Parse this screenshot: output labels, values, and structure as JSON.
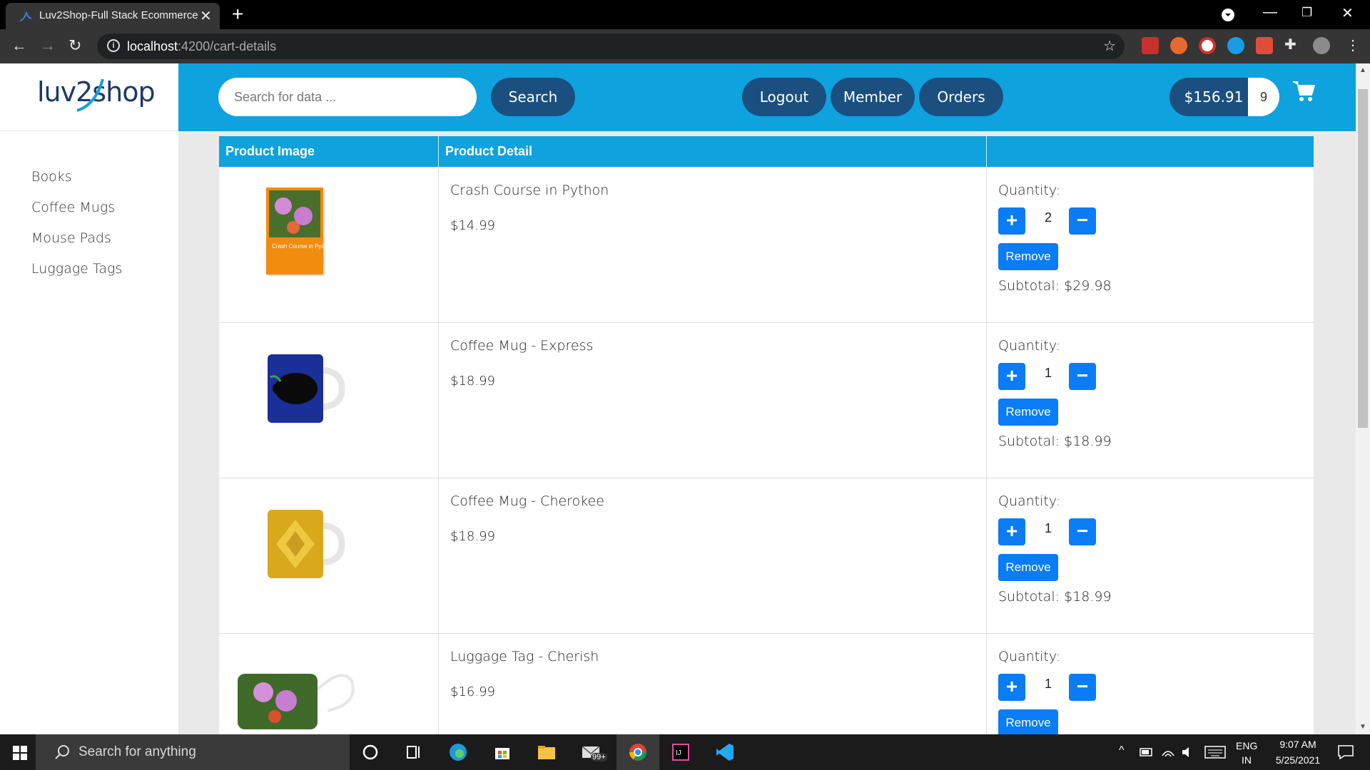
{
  "browser": {
    "tab_title": "Luv2Shop-Full Stack Ecommerce",
    "url_host": "localhost",
    "url_path": ":4200/cart-details"
  },
  "logo": {
    "text": "luv2shop"
  },
  "sidebar": {
    "items": [
      {
        "label": "Books"
      },
      {
        "label": "Coffee Mugs"
      },
      {
        "label": "Mouse Pads"
      },
      {
        "label": "Luggage Tags"
      }
    ]
  },
  "header": {
    "search_placeholder": "Search for data ...",
    "search_button": "Search",
    "logout": "Logout",
    "member": "Member",
    "orders": "Orders",
    "cart_total": "$156.91",
    "cart_quantity": "9"
  },
  "table": {
    "headers": [
      "Product Image",
      "Product Detail",
      ""
    ],
    "quantity_label": "Quantity:",
    "remove_label": "Remove",
    "rows": [
      {
        "name": "Crash Course in Python",
        "price": "$14.99",
        "quantity": "2",
        "subtotal": "Subtotal: $29.98",
        "image": "book-cover",
        "book_title": "Crash Course in Python"
      },
      {
        "name": "Coffee Mug - Express",
        "price": "$18.99",
        "quantity": "1",
        "subtotal": "Subtotal: $18.99",
        "image": "blue-fractal-mug"
      },
      {
        "name": "Coffee Mug - Cherokee",
        "price": "$18.99",
        "quantity": "1",
        "subtotal": "Subtotal: $18.99",
        "image": "yellow-pattern-mug"
      },
      {
        "name": "Luggage Tag - Cherish",
        "price": "$16.99",
        "quantity": "1",
        "subtotal": "",
        "image": "orchid-luggage-tag"
      }
    ]
  },
  "taskbar": {
    "search_text": "Search for anything",
    "language": "ENG",
    "region": "IN",
    "time": "9:07 AM",
    "date": "5/25/2021",
    "mail_badge": "99+"
  },
  "colors": {
    "header_blue": "#0ea2de",
    "pill_navy": "#1a4f80",
    "button_blue": "#0a7cf5"
  }
}
